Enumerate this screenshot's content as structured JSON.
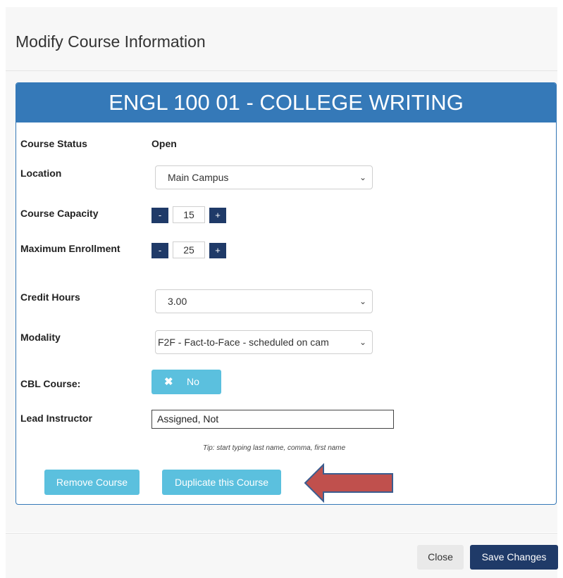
{
  "modal": {
    "title": "Modify Course Information"
  },
  "course": {
    "heading": "ENGL 100 01 - COLLEGE WRITING",
    "status_label": "Course Status",
    "status_value": "Open",
    "location_label": "Location",
    "location_value": "Main Campus",
    "capacity_label": "Course Capacity",
    "capacity_value": "15",
    "max_enrollment_label": "Maximum Enrollment",
    "max_enrollment_value": "25",
    "credit_hours_label": "Credit Hours",
    "credit_hours_value": "3.00",
    "modality_label": "Modality",
    "modality_value": "F2F - Fact-to-Face - scheduled on cam",
    "cbl_label": "CBL Course:",
    "cbl_value": "No",
    "lead_instructor_label": "Lead Instructor",
    "lead_instructor_value": "Assigned, Not",
    "tip": "Tip: start typing last name, comma, first name",
    "stepper_minus": "-",
    "stepper_plus": "+"
  },
  "actions": {
    "remove_label": "Remove Course",
    "duplicate_label": "Duplicate this Course"
  },
  "footer": {
    "close_label": "Close",
    "save_label": "Save Changes"
  },
  "icons": {
    "dropdown": "chevron-down-icon",
    "cbl_toggle": "close-icon",
    "annotation": "arrow-left-icon"
  },
  "colors": {
    "panel_header": "#3579b8",
    "primary_dark": "#1f3a68",
    "info": "#5bc0de",
    "arrow_fill": "#c0504d",
    "arrow_stroke": "#3b5d8f"
  }
}
